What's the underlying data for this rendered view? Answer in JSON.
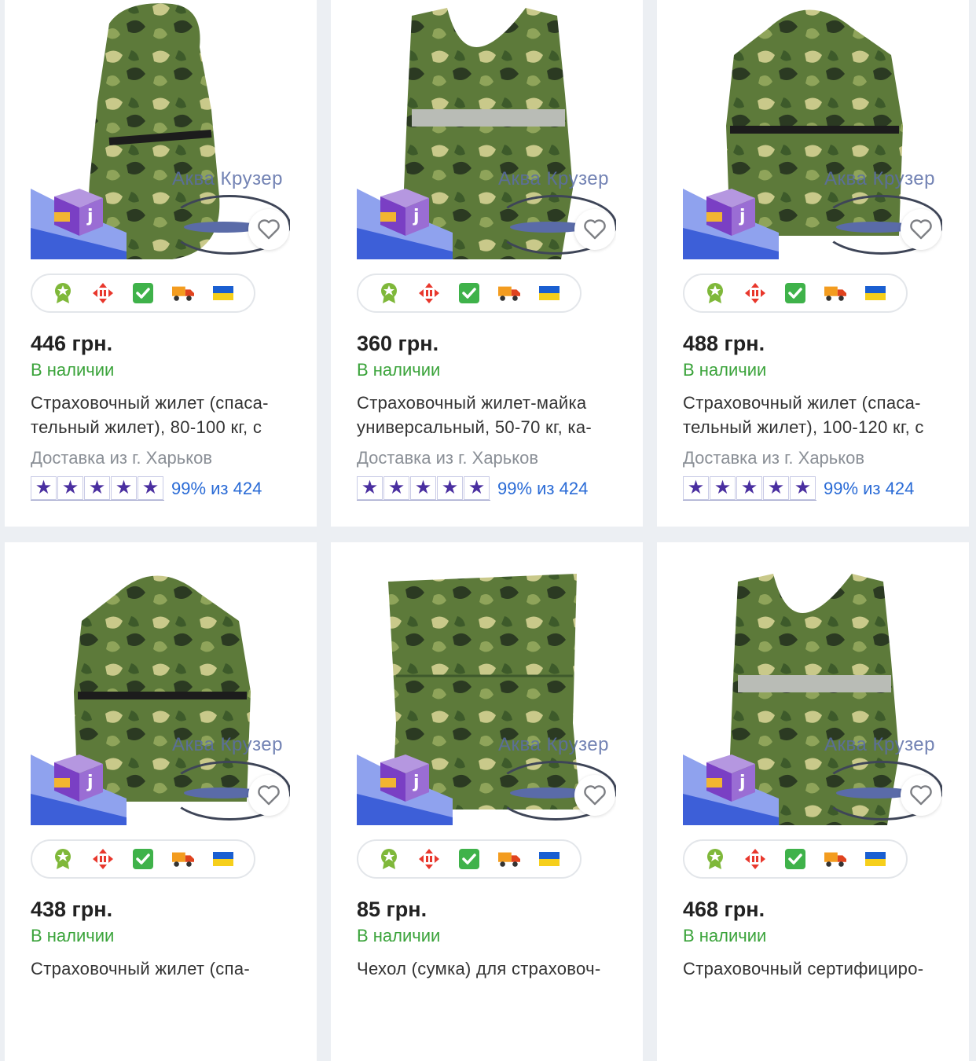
{
  "currency": "грн.",
  "cards": [
    {
      "price": "446 грн.",
      "availability": "В наличии",
      "title": "Страховочный жилет (спаса-\nтельный жилет), 80-100 кг, с",
      "delivery": "Доставка из г. Харьков",
      "rating_text": "99% из 424",
      "stars": 5,
      "watermark": "Аква Крузер",
      "vest_style": "hood"
    },
    {
      "price": "360 грн.",
      "availability": "В наличии",
      "title": "Страховочный жилет-майка\nуниверсальный, 50-70 кг, ка-",
      "delivery": "Доставка из г. Харьков",
      "rating_text": "99% из 424",
      "stars": 5,
      "watermark": "Аква Крузер",
      "vest_style": "tank"
    },
    {
      "price": "488 грн.",
      "availability": "В наличии",
      "title": "Страховочный жилет (спаса-\nтельный жилет), 100-120 кг, с",
      "delivery": "Доставка из г. Харьков",
      "rating_text": "99% из 424",
      "stars": 5,
      "watermark": "Аква Крузер",
      "vest_style": "collar"
    },
    {
      "price": "438 грн.",
      "availability": "В наличии",
      "title": "Страховочный жилет (спа-",
      "watermark": "Аква Крузер",
      "vest_style": "collar"
    },
    {
      "price": "85 грн.",
      "availability": "В наличии",
      "title": "Чехол (сумка) для страховоч-",
      "watermark": "Аква Крузер",
      "vest_style": "bag"
    },
    {
      "price": "468 грн.",
      "availability": "В наличии",
      "title": "Страховочный сертифициро-",
      "watermark": "Аква Крузер",
      "vest_style": "tank"
    }
  ],
  "badge_icons": [
    "award-icon",
    "nova-poshta-icon",
    "check-icon",
    "truck-icon",
    "ukraine-flag-icon"
  ],
  "colors": {
    "price": "#222222",
    "in_stock": "#3aa33a",
    "delivery": "#8a8f96",
    "rating_link": "#2a6bd6",
    "star": "#4a2fa0",
    "background": "#eceff3",
    "camo_light": "#c9c98a",
    "camo_mid": "#5d7a3a",
    "camo_dark": "#2b3a22"
  }
}
